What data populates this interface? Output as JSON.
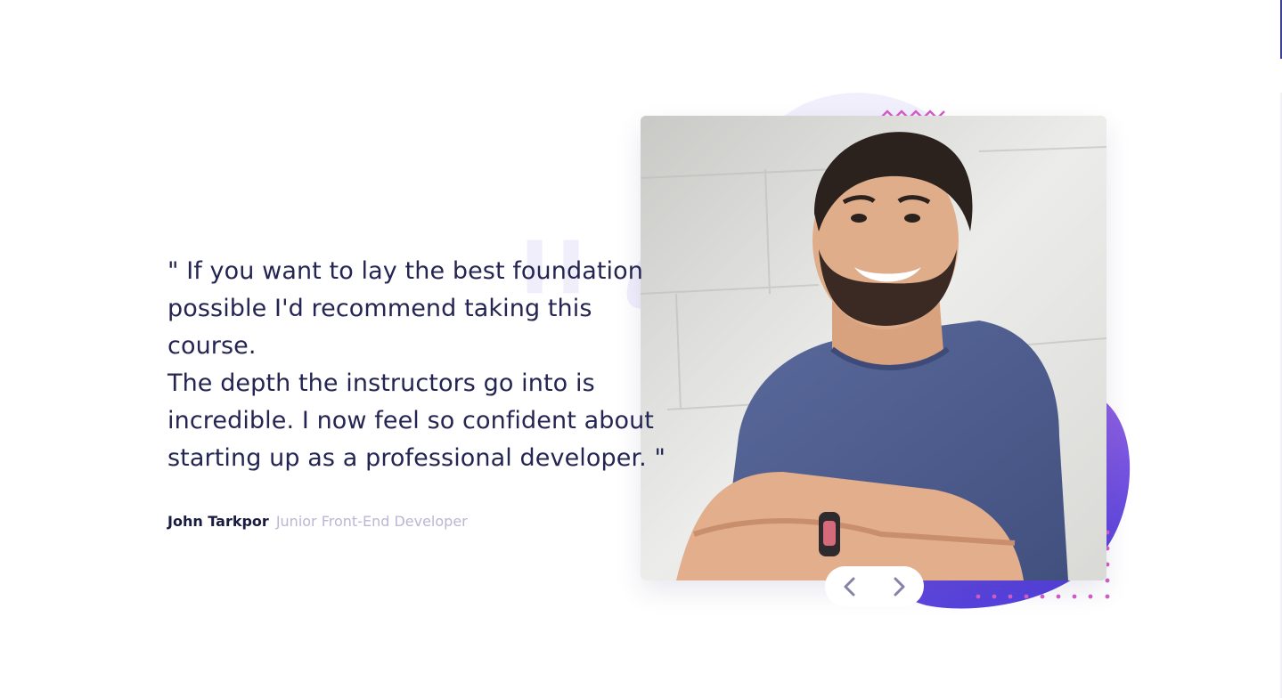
{
  "testimonial": {
    "quote_lines": [
      "\" If you want to lay the best foundation",
      "possible I'd recommend taking this course.",
      "The depth the instructors go into is",
      "incredible. I now feel so confident about",
      "starting up as a professional developer. \""
    ],
    "author_name": "John Tarkpor",
    "author_role": "Junior Front-End Developer"
  },
  "photo": {
    "alt": "Smiling man with crossed arms wearing a blue t-shirt"
  },
  "navigation": {
    "prev_icon": "chevron-left-icon",
    "next_icon": "chevron-right-icon"
  },
  "colors": {
    "quote_text": "#242552",
    "author_name": "#1a1b41",
    "author_role": "#b9b7d4",
    "accent_purple_start": "#9a62e0",
    "accent_purple_end": "#5742dd",
    "dots_pink": "#d35ec8",
    "chevron": "#8582a8"
  }
}
